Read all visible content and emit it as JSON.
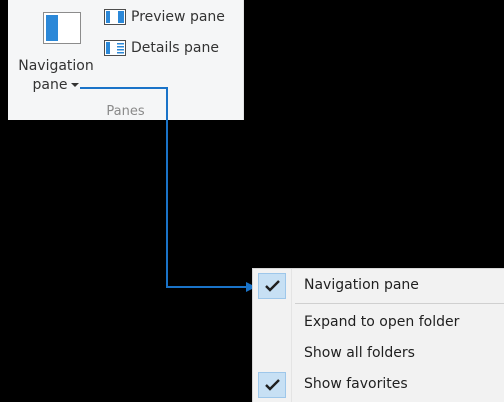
{
  "ribbon": {
    "navigation_pane_label_line1": "Navigation",
    "navigation_pane_label_line2": "pane",
    "preview_pane_label": "Preview pane",
    "details_pane_label": "Details pane",
    "group_label": "Panes"
  },
  "menu": {
    "items": [
      {
        "label": "Navigation pane",
        "checked": true
      },
      {
        "label": "Expand to open folder",
        "checked": false
      },
      {
        "label": "Show all folders",
        "checked": false
      },
      {
        "label": "Show favorites",
        "checked": true
      }
    ]
  },
  "colors": {
    "accent": "#2b88d8",
    "connector": "#1a73c8",
    "check_highlight": "#c7e0f4"
  },
  "icons": {
    "navigation_pane": "navigation-pane-icon",
    "preview_pane": "preview-pane-icon",
    "details_pane": "details-pane-icon",
    "checkmark": "checkmark-icon",
    "dropdown": "chevron-down-icon"
  }
}
